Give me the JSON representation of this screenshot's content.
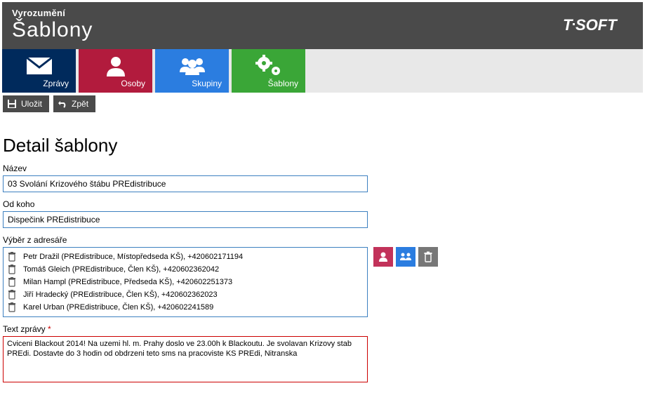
{
  "header": {
    "breadcrumb": "Vyrozumění",
    "title": "Šablony"
  },
  "tabs": {
    "zpravy": "Zprávy",
    "osoby": "Osoby",
    "skupiny": "Skupiny",
    "sablony": "Šablony"
  },
  "toolbar": {
    "save": "Uložit",
    "back": "Zpět"
  },
  "section_title": "Detail šablony",
  "labels": {
    "name": "Název",
    "from": "Od koho",
    "pick": "Výběr z adresáře",
    "msg": "Text zprávy ",
    "required_mark": "*"
  },
  "fields": {
    "name": "03 Svolání Krizového štábu PREdistribuce",
    "from": "Dispečink PREdistribuce",
    "msg": "Cviceni Blackout 2014! Na uzemi hl. m. Prahy doslo ve 23.00h k Blackoutu. Je svolavan Krizovy stab PREdi. Dostavte do 3 hodin od obdrzeni teto sms na pracoviste KS PREdi, Nitranska"
  },
  "recipients": [
    "Petr Dražil (PREdistribuce, Místopředseda KŠ), +420602171194",
    "Tomáš Gleich (PREdistribuce, Člen KŠ), +420602362042",
    "Milan Hampl (PREdistribuce, Předseda KŠ), +420602251373",
    "Jiří Hradecký (PREdistribuce, Člen KŠ), +420602362023",
    "Karel Urban (PREdistribuce, Člen KŠ), +420602241589"
  ]
}
